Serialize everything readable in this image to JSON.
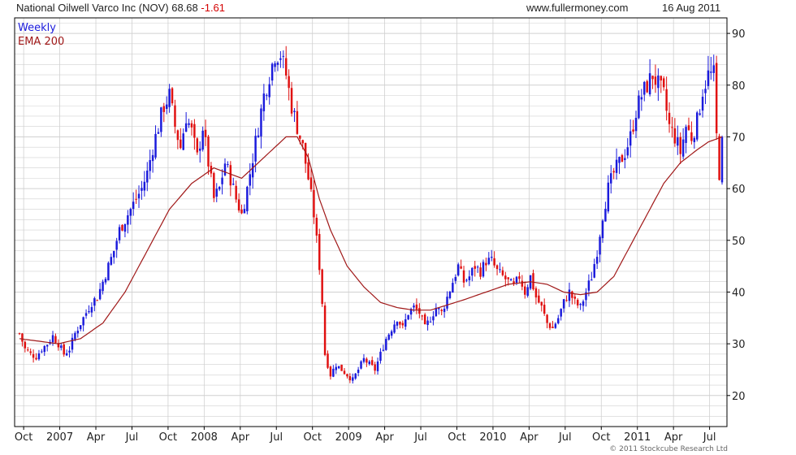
{
  "header": {
    "title": "National Oilwell Varco Inc (NOV)",
    "last": "68.68",
    "change": "-1.61",
    "site": "www.fullermoney.com",
    "date": "16 Aug 2011"
  },
  "footer": {
    "copyright": "© 2011 Stockcube Research Ltd"
  },
  "colors": {
    "up": "#1a1adc",
    "down": "#e01010",
    "ema": "#a01818",
    "grid": "#d0d0d0",
    "frame": "#000000",
    "legend_weekly": "#1a1adc",
    "legend_ema": "#a01818"
  },
  "chart_data": {
    "type": "candlestick",
    "title": "National Oilwell Varco Inc (NOV)",
    "xlabel": "",
    "ylabel": "",
    "ylim": [
      14,
      93
    ],
    "y_ticks": [
      20,
      30,
      40,
      50,
      60,
      70,
      80,
      90
    ],
    "grid": true,
    "legend_position": "top-left",
    "x_ticks": [
      {
        "label": "Oct",
        "week": 1.5
      },
      {
        "label": "2007",
        "week": 14.5
      },
      {
        "label": "Apr",
        "week": 27.5
      },
      {
        "label": "Jul",
        "week": 40.5
      },
      {
        "label": "Oct",
        "week": 53.5
      },
      {
        "label": "2008",
        "week": 66.5
      },
      {
        "label": "Apr",
        "week": 79.5
      },
      {
        "label": "Jul",
        "week": 92.5
      },
      {
        "label": "Oct",
        "week": 105.5
      },
      {
        "label": "2009",
        "week": 118.5
      },
      {
        "label": "Apr",
        "week": 131.5
      },
      {
        "label": "Jul",
        "week": 144.5
      },
      {
        "label": "Oct",
        "week": 157.5
      },
      {
        "label": "2010",
        "week": 170.5
      },
      {
        "label": "Apr",
        "week": 183.5
      },
      {
        "label": "Jul",
        "week": 196.5
      },
      {
        "label": "Oct",
        "week": 209.5
      },
      {
        "label": "2011",
        "week": 222.5
      },
      {
        "label": "Apr",
        "week": 235.5
      },
      {
        "label": "Jul",
        "week": 248.5
      }
    ],
    "series": [
      {
        "name": "Weekly",
        "style": "candlestick",
        "anchors": [
          [
            0,
            32
          ],
          [
            2,
            29
          ],
          [
            4,
            28
          ],
          [
            6,
            27.5
          ],
          [
            8,
            29
          ],
          [
            10,
            30
          ],
          [
            12,
            31.5
          ],
          [
            14,
            30
          ],
          [
            16,
            28
          ],
          [
            18,
            29
          ],
          [
            20,
            32
          ],
          [
            22,
            34
          ],
          [
            24,
            36
          ],
          [
            26,
            38
          ],
          [
            28,
            39
          ],
          [
            30,
            42
          ],
          [
            32,
            45
          ],
          [
            34,
            48
          ],
          [
            36,
            52
          ],
          [
            38,
            54
          ],
          [
            40,
            56
          ],
          [
            42,
            58
          ],
          [
            44,
            60
          ],
          [
            46,
            63
          ],
          [
            48,
            68
          ],
          [
            50,
            72
          ],
          [
            52,
            76
          ],
          [
            54,
            78
          ],
          [
            56,
            72
          ],
          [
            58,
            68
          ],
          [
            60,
            74
          ],
          [
            62,
            71
          ],
          [
            64,
            66
          ],
          [
            66,
            72
          ],
          [
            68,
            65
          ],
          [
            70,
            58
          ],
          [
            72,
            60
          ],
          [
            74,
            65
          ],
          [
            76,
            62
          ],
          [
            78,
            58
          ],
          [
            80,
            55
          ],
          [
            82,
            60
          ],
          [
            84,
            66
          ],
          [
            86,
            72
          ],
          [
            88,
            78
          ],
          [
            90,
            82
          ],
          [
            92,
            86
          ],
          [
            94,
            86
          ],
          [
            96,
            82
          ],
          [
            98,
            76
          ],
          [
            100,
            72
          ],
          [
            102,
            68
          ],
          [
            104,
            62
          ],
          [
            106,
            55
          ],
          [
            108,
            45
          ],
          [
            109,
            38
          ],
          [
            110,
            28
          ],
          [
            112,
            24
          ],
          [
            114,
            26
          ],
          [
            116,
            25
          ],
          [
            118,
            24
          ],
          [
            120,
            23
          ],
          [
            122,
            25
          ],
          [
            124,
            27
          ],
          [
            126,
            26
          ],
          [
            128,
            25
          ],
          [
            130,
            28
          ],
          [
            132,
            31
          ],
          [
            134,
            33
          ],
          [
            136,
            35
          ],
          [
            138,
            33
          ],
          [
            140,
            36
          ],
          [
            142,
            37
          ],
          [
            144,
            36
          ],
          [
            146,
            33
          ],
          [
            148,
            35
          ],
          [
            150,
            37
          ],
          [
            152,
            36
          ],
          [
            154,
            39
          ],
          [
            156,
            42
          ],
          [
            158,
            45
          ],
          [
            160,
            42
          ],
          [
            162,
            43
          ],
          [
            164,
            45
          ],
          [
            166,
            44
          ],
          [
            168,
            46
          ],
          [
            170,
            46
          ],
          [
            172,
            44
          ],
          [
            174,
            43
          ],
          [
            176,
            42
          ],
          [
            178,
            41
          ],
          [
            180,
            43
          ],
          [
            182,
            40
          ],
          [
            184,
            43
          ],
          [
            186,
            39
          ],
          [
            188,
            37
          ],
          [
            190,
            34
          ],
          [
            192,
            33
          ],
          [
            194,
            35
          ],
          [
            196,
            38
          ],
          [
            198,
            40
          ],
          [
            200,
            38
          ],
          [
            202,
            37
          ],
          [
            204,
            40
          ],
          [
            206,
            43
          ],
          [
            208,
            48
          ],
          [
            210,
            55
          ],
          [
            212,
            60
          ],
          [
            214,
            63
          ],
          [
            216,
            65
          ],
          [
            218,
            67
          ],
          [
            220,
            70
          ],
          [
            222,
            75
          ],
          [
            224,
            78
          ],
          [
            226,
            80
          ],
          [
            228,
            82
          ],
          [
            230,
            80
          ],
          [
            232,
            78
          ],
          [
            234,
            72
          ],
          [
            236,
            70
          ],
          [
            238,
            67
          ],
          [
            240,
            72
          ],
          [
            242,
            70
          ],
          [
            244,
            73
          ],
          [
            246,
            79
          ],
          [
            248,
            82
          ],
          [
            250,
            82
          ],
          [
            251,
            70
          ],
          [
            252,
            63
          ],
          [
            253,
            68.68
          ]
        ]
      },
      {
        "name": "EMA 200",
        "style": "line",
        "values": [
          [
            0,
            31
          ],
          [
            14,
            30
          ],
          [
            22,
            31
          ],
          [
            30,
            34
          ],
          [
            38,
            40
          ],
          [
            46,
            48
          ],
          [
            54,
            56
          ],
          [
            62,
            61
          ],
          [
            70,
            64
          ],
          [
            80,
            62
          ],
          [
            88,
            66
          ],
          [
            96,
            70
          ],
          [
            100,
            70
          ],
          [
            104,
            66
          ],
          [
            108,
            58
          ],
          [
            112,
            52
          ],
          [
            118,
            45
          ],
          [
            124,
            41
          ],
          [
            130,
            38
          ],
          [
            136,
            37
          ],
          [
            142,
            36.5
          ],
          [
            148,
            36.5
          ],
          [
            154,
            37.5
          ],
          [
            160,
            38.5
          ],
          [
            168,
            40
          ],
          [
            176,
            41.5
          ],
          [
            184,
            42
          ],
          [
            190,
            41.5
          ],
          [
            196,
            40
          ],
          [
            202,
            39.5
          ],
          [
            208,
            40
          ],
          [
            214,
            43
          ],
          [
            220,
            49
          ],
          [
            226,
            55
          ],
          [
            232,
            61
          ],
          [
            238,
            65
          ],
          [
            244,
            67.5
          ],
          [
            248,
            69
          ],
          [
            253,
            70
          ]
        ]
      }
    ]
  }
}
